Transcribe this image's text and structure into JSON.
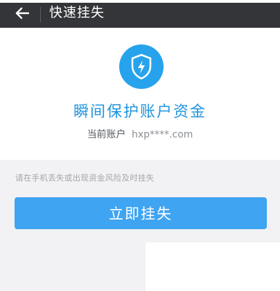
{
  "nav": {
    "back_icon": "arrow-left-icon",
    "title": "快速挂失"
  },
  "card": {
    "icon": "shield-lightning-icon",
    "headline": "瞬间保护账户资金",
    "account_label": "当前账户",
    "account_value": "hxp****.com"
  },
  "hint": "请在手机丢失或出现资金风险及时挂失",
  "action": {
    "button_label": "立即挂失"
  },
  "colors": {
    "nav_bg": "#333538",
    "accent": "#26a3ec",
    "button": "#3fa4f1",
    "page_bg": "#f2f2f4"
  }
}
